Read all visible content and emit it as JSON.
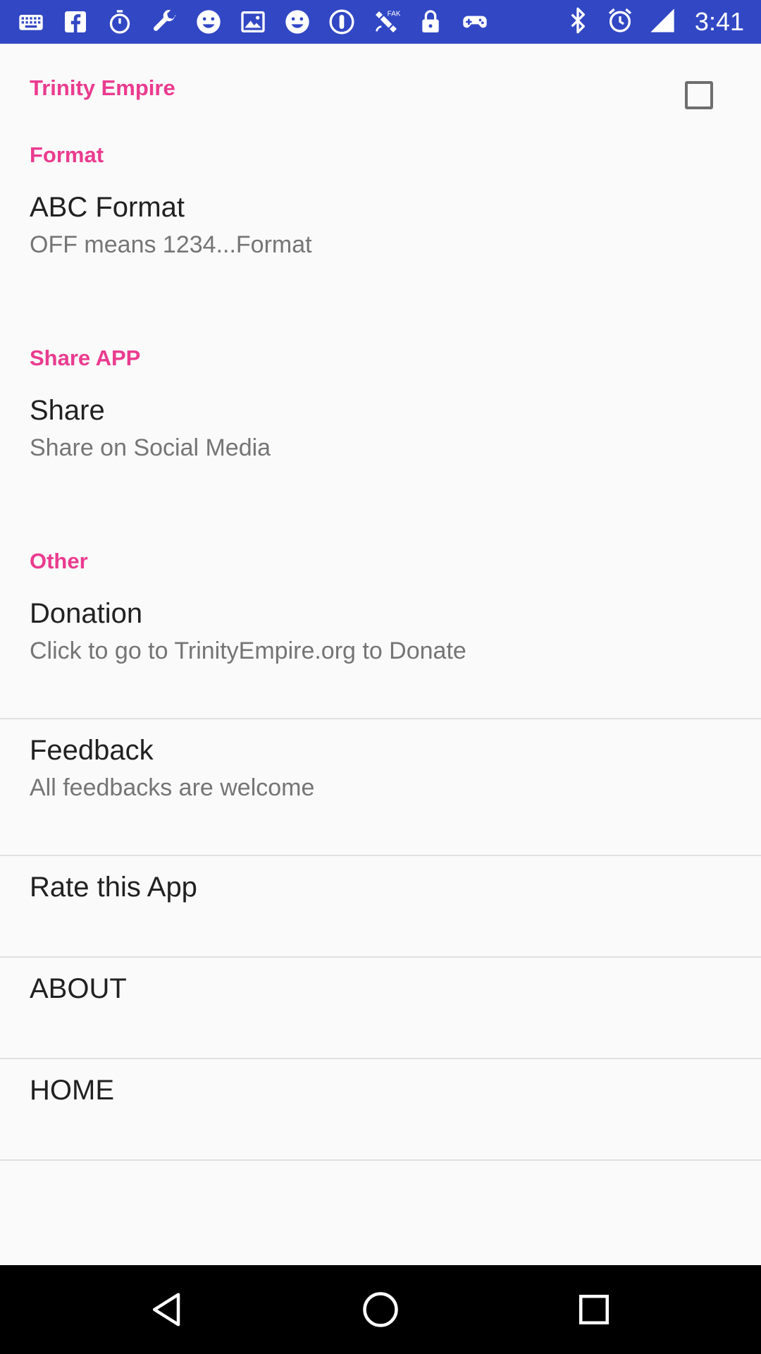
{
  "status_bar": {
    "time": "3:41",
    "notification_icons": [
      "keyboard-icon",
      "facebook-icon",
      "stopwatch-icon",
      "wrench-icon",
      "smiley-icon",
      "image-icon",
      "smiley-icon",
      "circle-badge-icon",
      "fake-gps-satellite-icon",
      "lock-icon",
      "game-controller-icon"
    ],
    "system_icons": [
      "bluetooth-icon",
      "alarm-icon",
      "signal-icon"
    ],
    "background_color": "#3247c4"
  },
  "settings": {
    "app_category": "Trinity Empire",
    "format_category": "Format",
    "abc_format": {
      "title": "ABC Format",
      "summary": "OFF means 1234...Format",
      "checked": false
    },
    "share_category": "Share APP",
    "share": {
      "title": "Share",
      "summary": "Share on Social Media"
    },
    "other_category": "Other",
    "donation": {
      "title": "Donation",
      "summary": "Click to go to TrinityEmpire.org to Donate"
    },
    "feedback": {
      "title": "Feedback",
      "summary": "All feedbacks are welcome"
    },
    "rate": {
      "title": "Rate this App"
    },
    "about": {
      "title": "ABOUT"
    },
    "home": {
      "title": "HOME"
    }
  },
  "colors": {
    "accent": "#ea3b8f",
    "primary_text": "#212121",
    "secondary_text": "#757575"
  },
  "nav_bar": {
    "buttons": [
      "back-icon",
      "home-icon",
      "recents-icon"
    ]
  }
}
